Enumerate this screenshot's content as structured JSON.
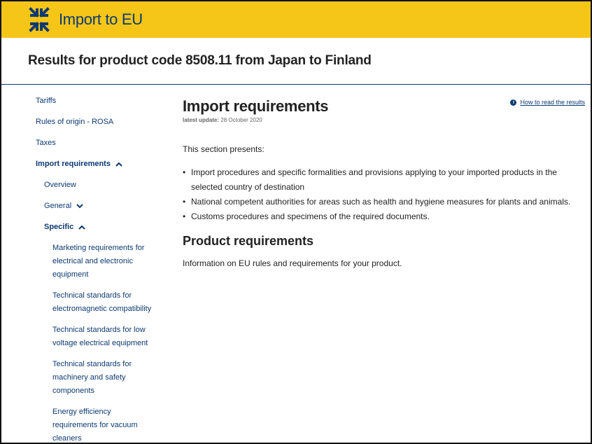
{
  "header": {
    "app_title": "Import to EU",
    "logo_icon": "arrows-inward-icon",
    "colors": {
      "bar": "#f5c518",
      "brand_blue": "#0c3a72"
    }
  },
  "results": {
    "title": "Results for product code 8508.11 from Japan to Finland"
  },
  "sidebar": {
    "items": [
      {
        "label": "Tariffs"
      },
      {
        "label": "Rules of origin - ROSA"
      },
      {
        "label": "Taxes"
      },
      {
        "label": "Import requirements",
        "chevron": "up"
      },
      {
        "label": "Overview"
      },
      {
        "label": "General",
        "chevron": "down"
      },
      {
        "label": "Specific",
        "chevron": "up"
      },
      {
        "label": "Marketing requirements for electrical and electronic equipment"
      },
      {
        "label": "Technical standards for electromagnetic compatibility"
      },
      {
        "label": "Technical standards for low voltage electrical equipment"
      },
      {
        "label": "Technical standards for machinery and safety components"
      },
      {
        "label": "Energy efficiency requirements for vacuum cleaners"
      }
    ]
  },
  "main": {
    "how_to_read_link": "How to read the results",
    "title": "Import requirements",
    "last_update_label": "latest update:",
    "last_update_value": "28 October 2020",
    "intro": "This section presents:",
    "bullets": [
      "Import procedures and specific formalities and provisions applying to your imported products in the selected country of destination",
      "National competent authorities for areas such as health and hygiene measures for plants and animals.",
      "Customs procedures and specimens of the required documents."
    ],
    "product_requirements_title": "Product requirements",
    "product_requirements_text": "Information on EU rules and requirements for your product."
  }
}
